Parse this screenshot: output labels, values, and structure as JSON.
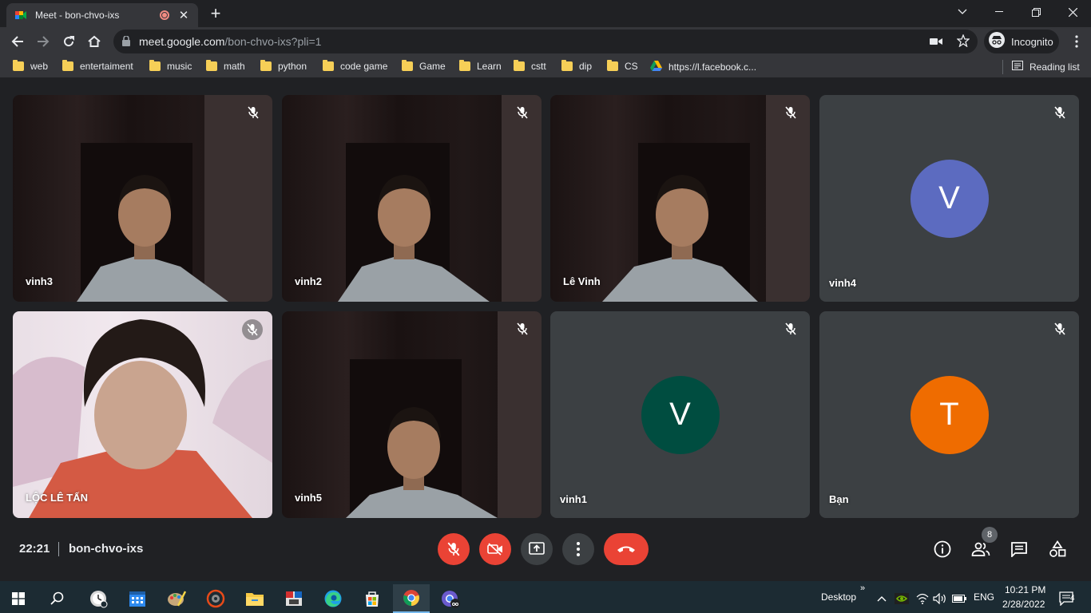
{
  "browser": {
    "tab_title": "Meet - bon-chvo-ixs",
    "url_host": "meet.google.com",
    "url_path": "/bon-chvo-ixs?pli=1",
    "profile_label": "Incognito",
    "reading_list": "Reading list"
  },
  "bookmarks": [
    {
      "label": "web",
      "icon": "folder-icon"
    },
    {
      "label": "entertaiment",
      "icon": "folder-icon"
    },
    {
      "label": "music",
      "icon": "folder-icon"
    },
    {
      "label": "math",
      "icon": "folder-icon"
    },
    {
      "label": "python",
      "icon": "folder-icon"
    },
    {
      "label": "code game",
      "icon": "folder-icon"
    },
    {
      "label": "Game",
      "icon": "folder-icon"
    },
    {
      "label": "Learn",
      "icon": "folder-icon"
    },
    {
      "label": "cstt",
      "icon": "folder-icon"
    },
    {
      "label": "dip",
      "icon": "folder-icon"
    },
    {
      "label": "CS",
      "icon": "folder-icon"
    },
    {
      "label": "https://l.facebook.c...",
      "icon": "google-drive-icon"
    }
  ],
  "participants": [
    {
      "name": "vinh3",
      "type": "video",
      "muted": true
    },
    {
      "name": "vinh2",
      "type": "video",
      "muted": true
    },
    {
      "name": "Lê Vinh",
      "type": "video",
      "muted": true
    },
    {
      "name": "vinh4",
      "type": "avatar",
      "initial": "V",
      "color": "#5c6bc0",
      "muted": true
    },
    {
      "name": "LỘC LÊ TẤN",
      "type": "video",
      "muted": true
    },
    {
      "name": "vinh5",
      "type": "video",
      "muted": true
    },
    {
      "name": "vinh1",
      "type": "avatar",
      "initial": "V",
      "color": "#004d40",
      "muted": true
    },
    {
      "name": "Bạn",
      "type": "avatar",
      "initial": "T",
      "color": "#ef6c00",
      "muted": true
    }
  ],
  "meeting": {
    "time": "22:21",
    "code": "bon-chvo-ixs",
    "people_count": "8"
  },
  "taskbar": {
    "desktop_label": "Desktop",
    "language": "ENG",
    "time": "10:21 PM",
    "date": "2/28/2022",
    "notification_count": "4"
  },
  "colors": {
    "meet_background": "#202124",
    "danger_red": "#ea4335",
    "control_gray": "#3c4043"
  }
}
